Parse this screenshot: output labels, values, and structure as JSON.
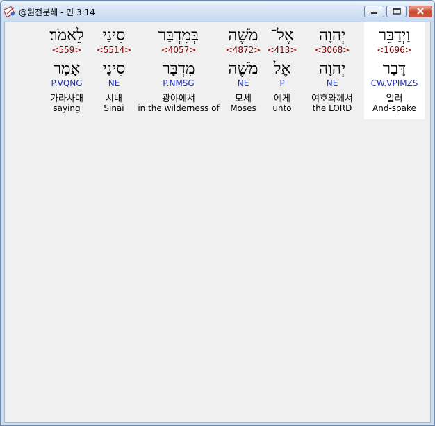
{
  "window": {
    "title": "@원전분해 - 민 3:14"
  },
  "controls": {
    "minimize": "minimize",
    "maximize": "maximize",
    "close": "close"
  },
  "words": [
    {
      "hebrew": "וַיְדַבֵּר",
      "strong": "<1696>",
      "lemma": "דָּבַר",
      "parsing": "CW.VPIMZS",
      "korean": "일러",
      "english": "And-spake",
      "selected": true
    },
    {
      "hebrew": "יְהוָה",
      "strong": "<3068>",
      "lemma": "יְהוָה",
      "parsing": "NE",
      "korean": "여호와께서",
      "english": "the LORD",
      "selected": false
    },
    {
      "hebrew": "אֶל־",
      "strong": "<413>",
      "lemma": "אֶל",
      "parsing": "P",
      "korean": "에게",
      "english": "unto",
      "selected": false
    },
    {
      "hebrew": "מֹשֶׁה",
      "strong": "<4872>",
      "lemma": "מֹשֶׁה",
      "parsing": "NE",
      "korean": "모세",
      "english": "Moses",
      "selected": false
    },
    {
      "hebrew": "בְּמִדְבַּר",
      "strong": "<4057>",
      "lemma": "מִדְבָּר",
      "parsing": "P.NMSG",
      "korean": "광야에서",
      "english": "in the wilderness of",
      "selected": false
    },
    {
      "hebrew": "סִינַי",
      "strong": "<5514>",
      "lemma": "סִינַי",
      "parsing": "NE",
      "korean": "시내",
      "english": "Sinai",
      "selected": false
    },
    {
      "hebrew": "לֵאמֹר׃",
      "strong": "<559>",
      "lemma": "אָמַר",
      "parsing": "P.VQNG",
      "korean": "가라사대",
      "english": "saying",
      "selected": false
    }
  ]
}
